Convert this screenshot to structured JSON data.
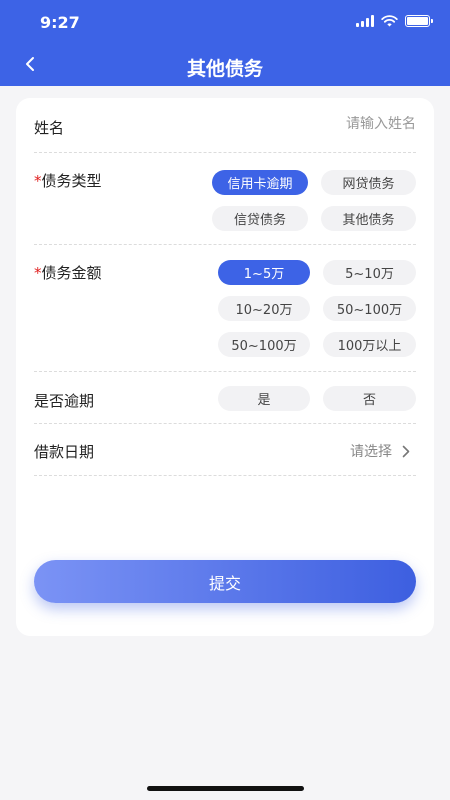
{
  "status_bar": {
    "time": "9:27"
  },
  "header": {
    "title": "其他债务",
    "back_icon": "chevron-left-icon"
  },
  "form": {
    "name": {
      "label": "姓名",
      "placeholder": "请输入姓名",
      "value": ""
    },
    "debt_type": {
      "required_mark": "*",
      "label": "债务类型",
      "options": [
        "信用卡逾期",
        "网贷债务",
        "信贷债务",
        "其他债务"
      ],
      "selected": "信用卡逾期"
    },
    "debt_amount": {
      "required_mark": "*",
      "label": "债务金额",
      "options": [
        "1~5万",
        "5~10万",
        "10~20万",
        "50~100万",
        "50~100万",
        "100万以上"
      ],
      "selected": "1~5万"
    },
    "overdue": {
      "label": "是否逾期",
      "options": [
        "是",
        "否"
      ],
      "selected": null
    },
    "loan_date": {
      "label": "借款日期",
      "value": "请选择",
      "chevron_icon": "chevron-right-icon"
    }
  },
  "submit": {
    "label": "提交"
  },
  "colors": {
    "primary": "#3d63e6",
    "chip_bg": "#f2f2f4",
    "required": "#e02020"
  }
}
